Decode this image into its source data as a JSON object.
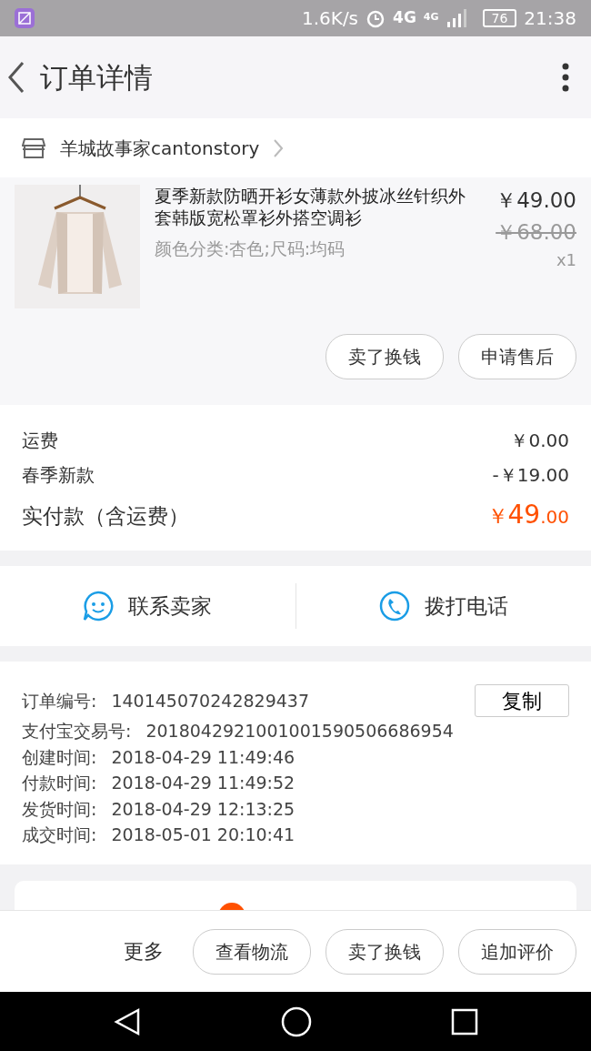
{
  "status_bar": {
    "speed": "1.6K/s",
    "network": "4G",
    "network_small": "4G",
    "battery": "76",
    "time": "21:38"
  },
  "header": {
    "title": "订单详情"
  },
  "shop": {
    "name": "羊城故事家cantonstory"
  },
  "product": {
    "kind": "picture",
    "title": "夏季新款防晒开衫女薄款外披冰丝针织外套韩版宽松罩衫外搭空调衫",
    "spec": "颜色分类:杏色;尺码:均码",
    "price": "￥49.00",
    "original_price": "￥68.00",
    "quantity": "x1",
    "actions": [
      "卖了换钱",
      "申请售后"
    ]
  },
  "fees": [
    {
      "label": "运费",
      "value": "￥0.00"
    },
    {
      "label": "春季新款",
      "value": "-￥19.00"
    }
  ],
  "total": {
    "label": "实付款（含运费）",
    "currency": "￥",
    "integer": "49",
    "decimal": ".00"
  },
  "contact": [
    {
      "kind": "chat",
      "label": "联系卖家"
    },
    {
      "kind": "phone",
      "label": "拨打电话"
    }
  ],
  "order_info": {
    "copy_button": "复制",
    "rows": [
      {
        "label": "订单编号:",
        "value": "140145070242829437"
      },
      {
        "label": "支付宝交易号:",
        "value": "2018042921001001590506686954"
      },
      {
        "label": "创建时间:",
        "value": "2018-04-29 11:49:46"
      },
      {
        "label": "付款时间:",
        "value": "2018-04-29 11:49:52"
      },
      {
        "label": "发货时间:",
        "value": "2018-04-29 12:13:25"
      },
      {
        "label": "成交时间:",
        "value": "2018-05-01 20:10:41"
      }
    ]
  },
  "bottom_bar": {
    "more": "更多",
    "actions": [
      "查看物流",
      "卖了换钱",
      "追加评价"
    ]
  }
}
